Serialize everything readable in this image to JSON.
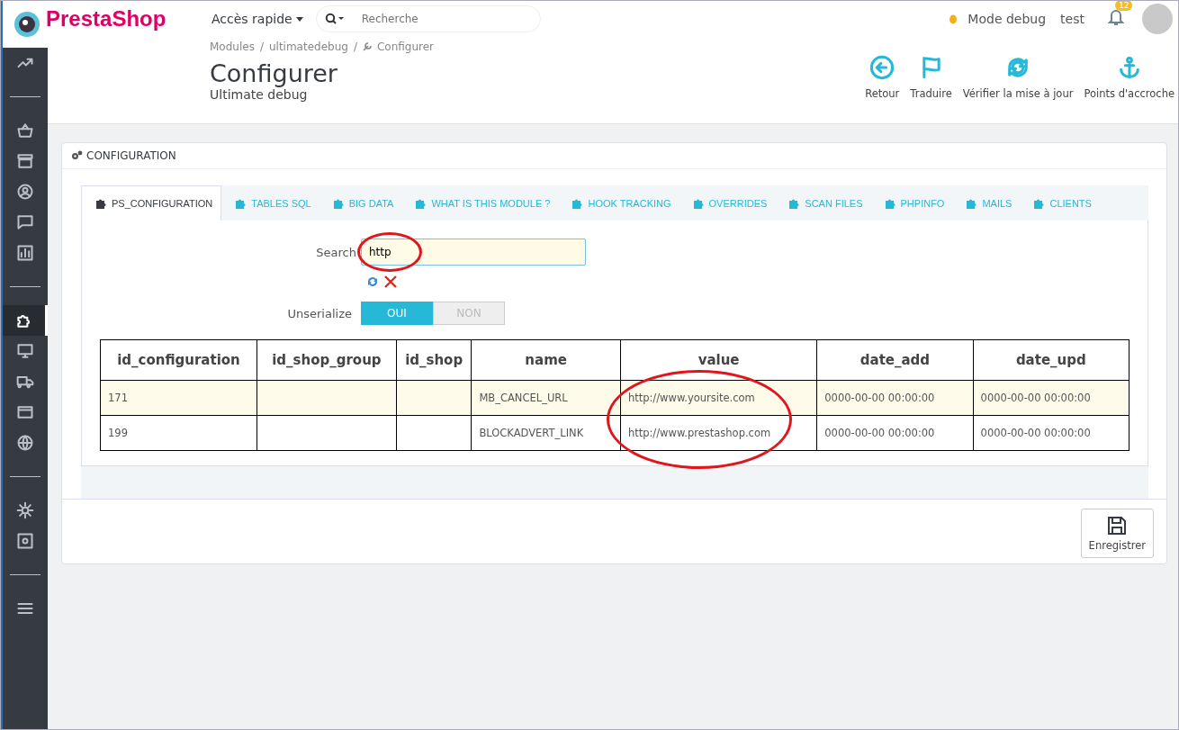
{
  "header": {
    "logo": "PrestaShop",
    "quick_access": "Accès rapide",
    "search": {
      "placeholder": "Recherche"
    },
    "debug_mode": "Mode debug",
    "shop": "test",
    "notifications": "12"
  },
  "sidebar": {
    "groups": [
      [
        {
          "selected": false
        }
      ],
      [
        {
          "selected": false
        },
        {
          "selected": false
        },
        {
          "selected": false
        },
        {
          "selected": false
        },
        {
          "selected": false
        }
      ],
      [
        {
          "selected": true
        },
        {
          "selected": false
        },
        {
          "selected": false
        },
        {
          "selected": false
        },
        {
          "selected": false
        }
      ],
      [
        {
          "selected": false
        },
        {
          "selected": false
        }
      ],
      [
        {
          "selected": false
        }
      ]
    ]
  },
  "breadcrumb": [
    {
      "label": "Modules",
      "separator": "/"
    },
    {
      "label": "ultimatedebug",
      "separator": "/"
    },
    {
      "label": "Configurer"
    }
  ],
  "page_title": "Configurer",
  "page_subtitle": "Ultimate debug",
  "toolbar": [
    "Retour",
    "Traduire",
    "Vérifier la mise à jour",
    "Points d'accroche"
  ],
  "panel": {
    "title": "CONFIGURATION",
    "tabs": [
      {
        "label": "PS_CONFIGURATION",
        "selected": true
      },
      {
        "label": "TABLES SQL",
        "selected": false
      },
      {
        "label": "BIG DATA",
        "selected": false
      },
      {
        "label": "WHAT IS THIS MODULE ?",
        "selected": false
      },
      {
        "label": "HOOK TRACKING",
        "selected": false
      },
      {
        "label": "OVERRIDES",
        "selected": false
      },
      {
        "label": "SCAN FILES",
        "selected": false
      },
      {
        "label": "PHPINFO",
        "selected": false
      },
      {
        "label": "MAILS",
        "selected": false
      },
      {
        "label": "CLIENTS",
        "selected": false
      }
    ],
    "search": {
      "label": "Search",
      "value": "http",
      "circled": true
    },
    "unserialize": {
      "label": "Unserialize",
      "options": [
        {
          "label": "OUI",
          "selected": true
        },
        {
          "label": "NON",
          "selected": false
        }
      ]
    },
    "table": {
      "columns": [
        {
          "label": "id_configuration",
          "circled": false
        },
        {
          "label": "id_shop_group",
          "circled": false
        },
        {
          "label": "id_shop",
          "circled": false
        },
        {
          "label": "name",
          "circled": false
        },
        {
          "label": "value",
          "circled": true
        },
        {
          "label": "date_add",
          "circled": false
        },
        {
          "label": "date_upd",
          "circled": false
        }
      ],
      "rows": [
        {
          "selected": true,
          "cells": [
            "171",
            "",
            "",
            "MB_CANCEL_URL",
            "http://www.yoursite.com",
            "0000-00-00 00:00:00",
            "0000-00-00 00:00:00"
          ]
        },
        {
          "selected": false,
          "cells": [
            "199",
            "",
            "",
            "BLOCKADVERT_LINK",
            "http://www.prestashop.com",
            "0000-00-00 00:00:00",
            "0000-00-00 00:00:00"
          ]
        }
      ]
    },
    "save_button": "Enregistrer"
  }
}
